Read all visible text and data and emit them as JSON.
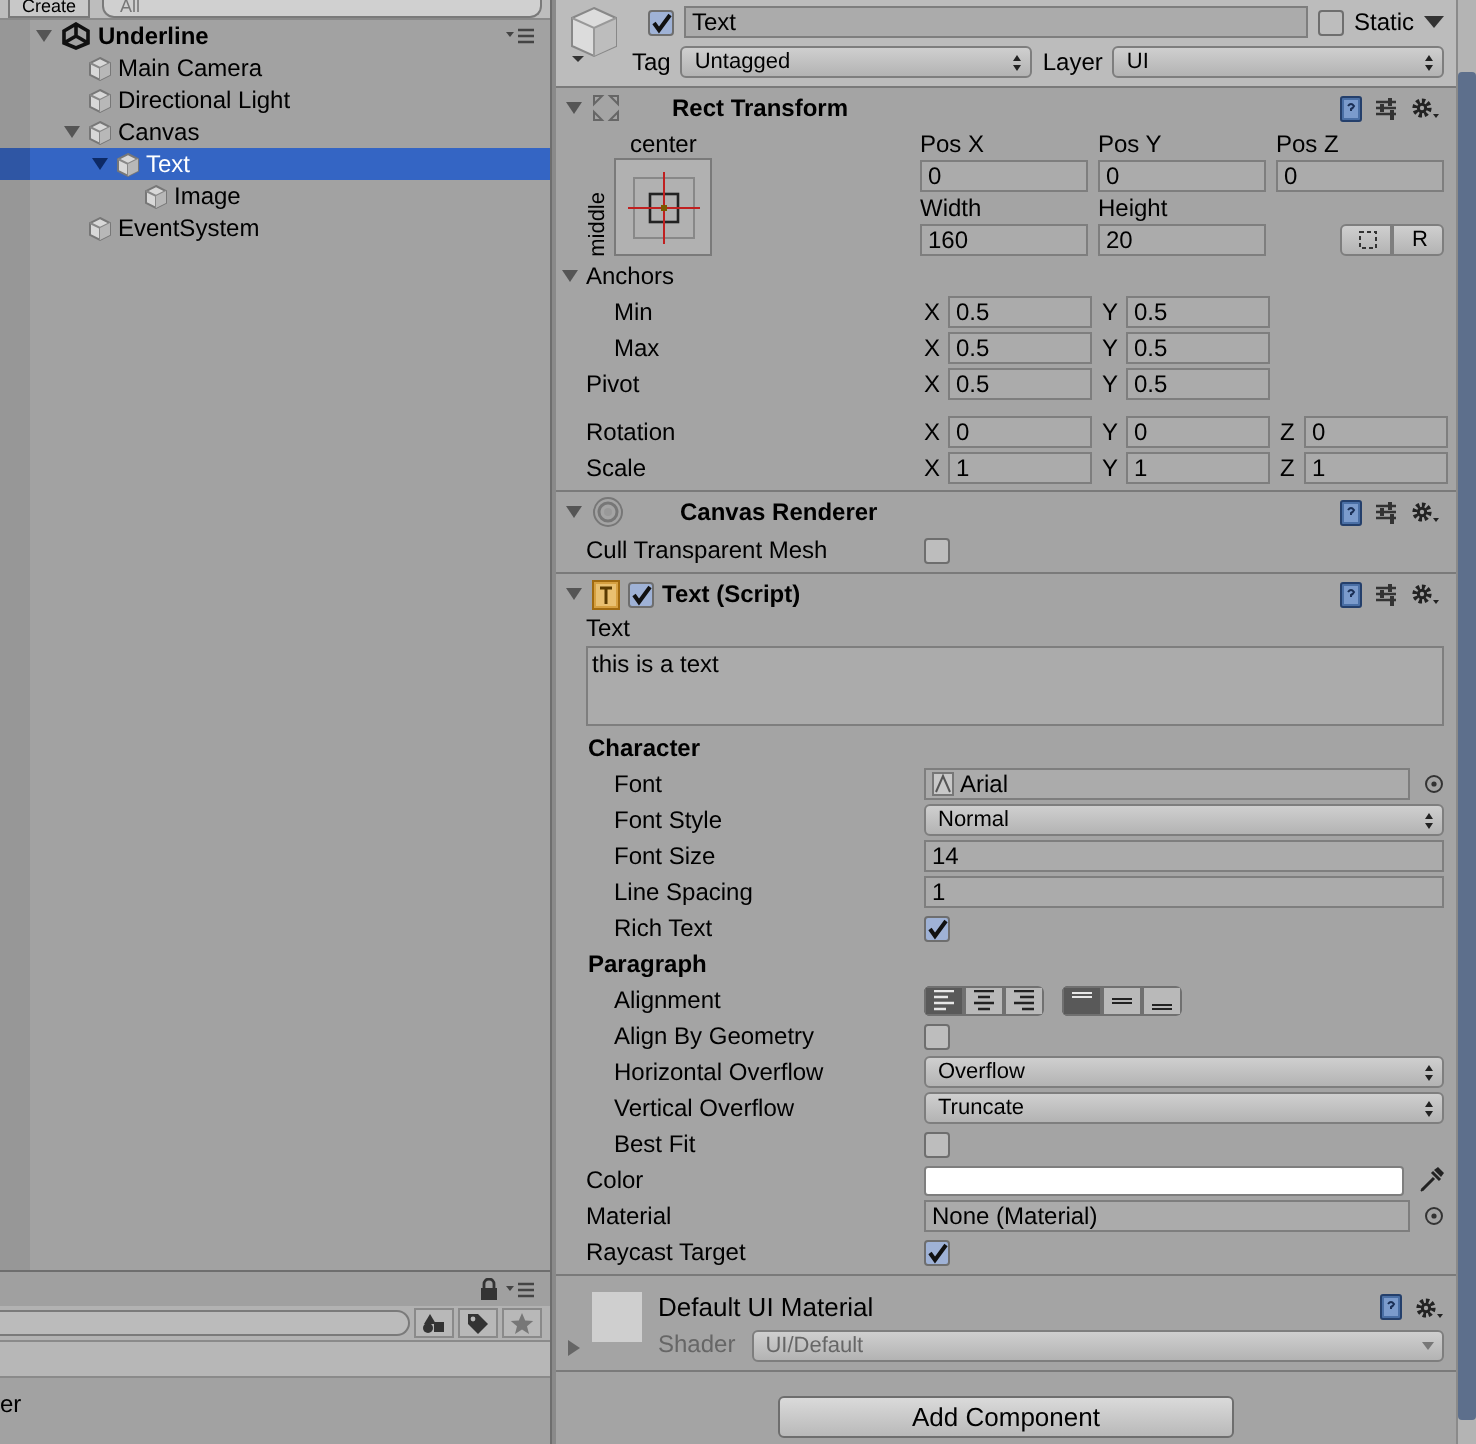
{
  "hierarchy": {
    "create": "Create",
    "search_placeholder": "All",
    "scene": "Underline",
    "scene_expanded": true,
    "items": [
      {
        "label": "Main Camera",
        "selected": false
      },
      {
        "label": "Directional Light",
        "selected": false
      },
      {
        "label": "Canvas",
        "selected": false,
        "expanded": true,
        "children": [
          {
            "label": "Text",
            "selected": true,
            "expanded": true,
            "children": [
              {
                "label": "Image",
                "selected": false
              }
            ]
          }
        ]
      },
      {
        "label": "EventSystem",
        "selected": false
      }
    ]
  },
  "project": {
    "visible_text": "er"
  },
  "inspector": {
    "active": true,
    "name": "Text",
    "static_label": "Static",
    "static": false,
    "tag_label": "Tag",
    "tag": "Untagged",
    "layer_label": "Layer",
    "layer": "UI",
    "rect_transform": {
      "title": "Rect Transform",
      "expanded": true,
      "anchor_h": "center",
      "anchor_v": "middle",
      "columns": [
        {
          "label": "Pos X",
          "value": "0"
        },
        {
          "label": "Pos Y",
          "value": "0"
        },
        {
          "label": "Pos Z",
          "value": "0"
        },
        {
          "label": "Width",
          "value": "160"
        },
        {
          "label": "Height",
          "value": "20"
        }
      ],
      "raw_button": "R",
      "vector_groups": [
        [
          {
            "label": "Anchors",
            "expanded": true,
            "children": [
              {
                "label": "Min",
                "axes": [
                  {
                    "axis": "X",
                    "value": "0.5"
                  },
                  {
                    "axis": "Y",
                    "value": "0.5"
                  }
                ]
              },
              {
                "label": "Max",
                "axes": [
                  {
                    "axis": "X",
                    "value": "0.5"
                  },
                  {
                    "axis": "Y",
                    "value": "0.5"
                  }
                ]
              }
            ]
          },
          {
            "label": "Pivot",
            "axes": [
              {
                "axis": "X",
                "value": "0.5"
              },
              {
                "axis": "Y",
                "value": "0.5"
              }
            ]
          }
        ],
        [
          {
            "label": "Rotation",
            "axes": [
              {
                "axis": "X",
                "value": "0"
              },
              {
                "axis": "Y",
                "value": "0"
              },
              {
                "axis": "Z",
                "value": "0"
              }
            ]
          },
          {
            "label": "Scale",
            "axes": [
              {
                "axis": "X",
                "value": "1"
              },
              {
                "axis": "Y",
                "value": "1"
              },
              {
                "axis": "Z",
                "value": "1"
              }
            ]
          }
        ]
      ]
    },
    "components": [
      {
        "title": "Canvas Renderer",
        "kind": "renderer",
        "expanded": true,
        "rows": [
          {
            "kind": "checkbox",
            "label": "Cull Transparent Mesh",
            "checked": false
          }
        ]
      },
      {
        "title": "Text (Script)",
        "kind": "text",
        "enabled": true,
        "expanded": true,
        "rows": [
          {
            "kind": "textarea",
            "label": "Text",
            "value": "this is a text"
          },
          {
            "kind": "section",
            "label": "Character",
            "children": [
              {
                "kind": "asset",
                "label": "Font",
                "value": "Arial"
              },
              {
                "kind": "dropdown",
                "label": "Font Style",
                "value": "Normal"
              },
              {
                "kind": "input",
                "label": "Font Size",
                "value": "14"
              },
              {
                "kind": "input",
                "label": "Line Spacing",
                "value": "1"
              },
              {
                "kind": "checkbox",
                "label": "Rich Text",
                "checked": true
              }
            ]
          },
          {
            "kind": "section",
            "label": "Paragraph",
            "children": [
              {
                "kind": "alignment",
                "label": "Alignment",
                "horizontal": [
                  {
                    "selected": true
                  },
                  {
                    "selected": false
                  },
                  {
                    "selected": false
                  }
                ],
                "vertical": [
                  {
                    "selected": true
                  },
                  {
                    "selected": false
                  },
                  {
                    "selected": false
                  }
                ]
              },
              {
                "kind": "checkbox",
                "label": "Align By Geometry",
                "checked": false
              },
              {
                "kind": "dropdown",
                "label": "Horizontal Overflow",
                "value": "Overflow"
              },
              {
                "kind": "dropdown",
                "label": "Vertical Overflow",
                "value": "Truncate"
              },
              {
                "kind": "checkbox",
                "label": "Best Fit",
                "checked": false
              }
            ]
          },
          {
            "kind": "color",
            "label": "Color",
            "color": "#ffffff"
          },
          {
            "kind": "object",
            "label": "Material",
            "value": "None (Material)"
          },
          {
            "kind": "checkbox",
            "label": "Raycast Target",
            "checked": true
          }
        ]
      }
    ],
    "material": {
      "name": "Default UI Material",
      "shader_label": "Shader",
      "shader": "UI/Default"
    },
    "add_component": "Add Component"
  }
}
